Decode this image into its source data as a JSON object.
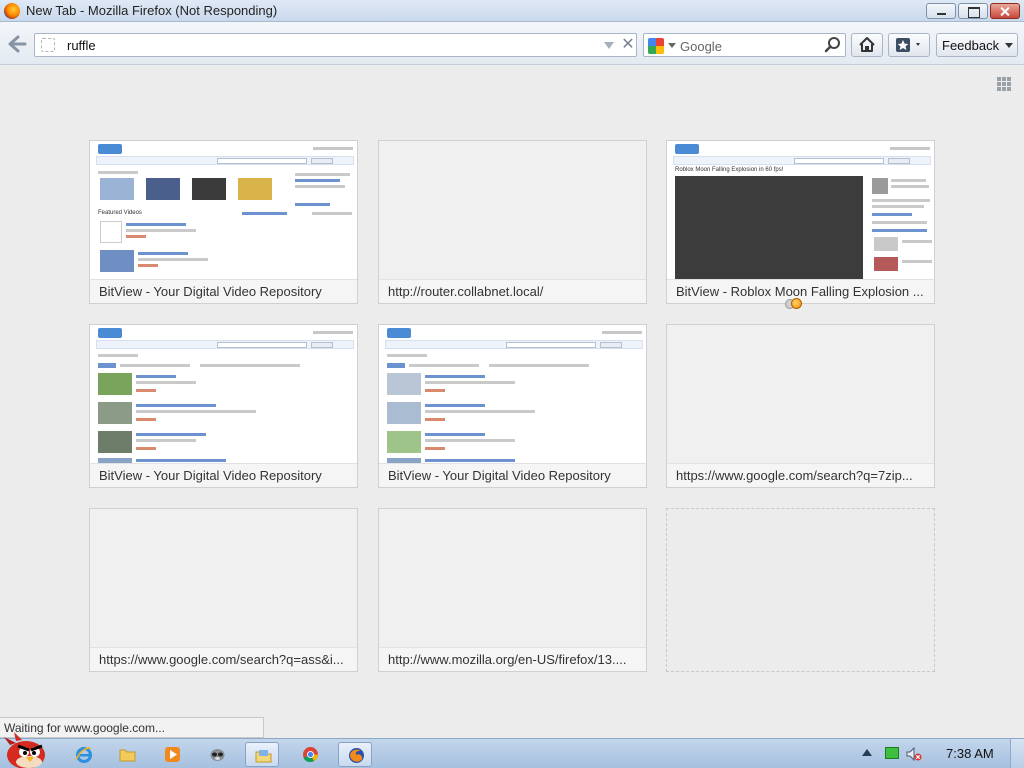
{
  "window": {
    "title": "New Tab - Mozilla Firefox (Not Responding)"
  },
  "navbar": {
    "url": "ruffle",
    "search_placeholder": "Google",
    "feedback_label": "Feedback"
  },
  "tiles": [
    {
      "caption": "BitView - Your Digital Video Repository"
    },
    {
      "caption": "http://router.collabnet.local/"
    },
    {
      "caption": "BitView - Roblox Moon Falling Explosion ..."
    },
    {
      "caption": "BitView - Your Digital Video Repository"
    },
    {
      "caption": "BitView - Your Digital Video Repository"
    },
    {
      "caption": "https://www.google.com/search?q=7zip..."
    },
    {
      "caption": "https://www.google.com/search?q=ass&i..."
    },
    {
      "caption": "http://www.mozilla.org/en-US/firefox/13...."
    }
  ],
  "tile_thumbs": {
    "brand": "BitView",
    "featured_heading": "Featured Videos",
    "video_title": "Roblox Moon Falling Explosion in 60 fps!"
  },
  "status": {
    "text": "Waiting for www.google.com..."
  },
  "taskbar": {
    "clock": "7:38 AM"
  },
  "colors": {
    "accent": "#4a8bd6",
    "titlebar": "#c9d9ec",
    "taskbar": "#a6c0df"
  },
  "icons": [
    "firefox-logo-icon",
    "back-arrow-icon",
    "site-identity-icon",
    "google-icon",
    "magnifier-icon",
    "home-icon",
    "bookmarks-icon",
    "grid-icon",
    "start-orb-icon",
    "ie-icon",
    "folder-icon",
    "media-player-icon",
    "raccoon-icon",
    "explorer-icon",
    "chrome-icon",
    "firefox-taskbar-icon",
    "volume-muted-icon",
    "network-icon"
  ]
}
